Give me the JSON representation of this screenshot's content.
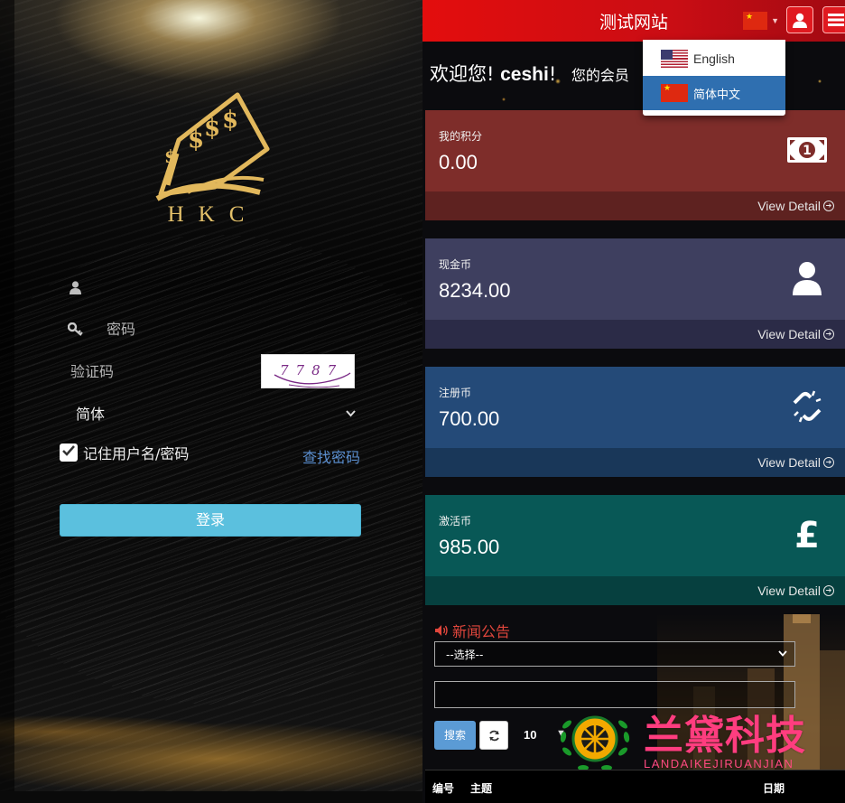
{
  "login": {
    "logo_text": "HKC",
    "username_placeholder": "",
    "password_placeholder": "密码",
    "captcha_placeholder": "验证码",
    "captcha_code": "7787",
    "language_value": "简体",
    "remember_label": "记住用户名/密码",
    "remember_checked": true,
    "forgot_link": "查找密码",
    "login_button": "登录",
    "accent_color": "#5bc0de"
  },
  "header": {
    "title": "测试网站",
    "brand_color": "#e30d0d"
  },
  "language_dropdown": {
    "items": [
      {
        "label": "English",
        "flag": "us-flag-icon",
        "selected": false
      },
      {
        "label": "简体中文",
        "flag": "cn-flag-icon",
        "selected": true
      }
    ]
  },
  "welcome": {
    "prefix": "欢迎您!",
    "username": "ceshi",
    "suffix": "!",
    "member_text": "您的会员"
  },
  "cards": [
    {
      "label": "我的积分",
      "value": "0.00",
      "link": "View Detail",
      "icon": "money-icon",
      "color": "#7e2d2a"
    },
    {
      "label": "现金币",
      "value": "8234.00",
      "link": "View Detail",
      "icon": "user-icon",
      "color": "#3e3f5f"
    },
    {
      "label": "注册币",
      "value": "700.00",
      "link": "View Detail",
      "icon": "unlink-icon",
      "color": "#244a78"
    },
    {
      "label": "激活币",
      "value": "985.00",
      "link": "View Detail",
      "icon": "pound-icon",
      "color": "#085856"
    }
  ],
  "news": {
    "title": "新闻公告",
    "select_value": "--选择--",
    "search_value": "",
    "search_button": "搜索",
    "page_size": "10",
    "columns": [
      "编号",
      "主题",
      "日期"
    ]
  },
  "watermark": {
    "text": "兰黛科技",
    "sub": "LANDAIKEJIRUANJIAN"
  }
}
